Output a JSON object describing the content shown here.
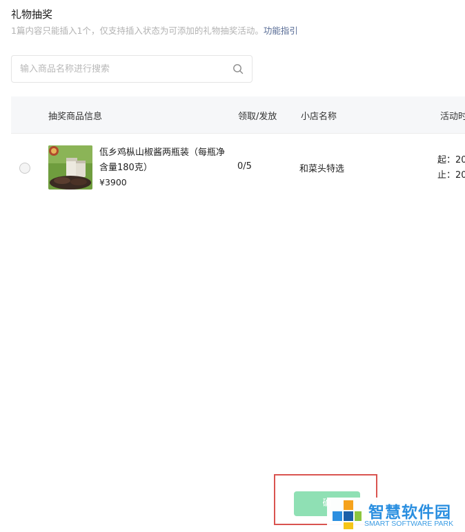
{
  "header": {
    "title": "礼物抽奖",
    "subtitle": "1篇内容只能插入1个，仅支持插入状态为可添加的礼物抽奖活动。",
    "guide_link": "功能指引"
  },
  "search": {
    "placeholder": "输入商品名称进行搜索",
    "value": ""
  },
  "table": {
    "columns": [
      "抽奖商品信息",
      "领取/发放",
      "小店名称",
      "活动时"
    ],
    "rows": [
      {
        "product_name": "佤乡鸡枞山椒酱两瓶装（每瓶净含量180克）",
        "price": "¥3900",
        "count": "0/5",
        "shop": "和菜头特选",
        "start": "起：20",
        "end": "止：20",
        "selected": false
      }
    ]
  },
  "footer": {
    "confirm_label": "确"
  },
  "watermark": {
    "main": "智慧软件园",
    "sub": "SMART SOFTWARE PARK"
  },
  "colors": {
    "link": "#576b95",
    "confirm_disabled": "#8fe0b4",
    "highlight_border": "#d9534f",
    "watermark": "#2b8fe0"
  }
}
